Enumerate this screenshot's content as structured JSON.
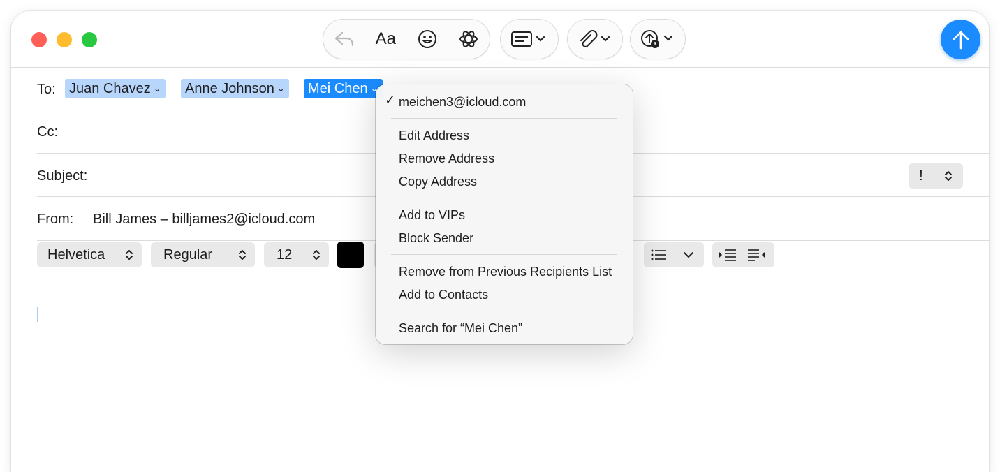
{
  "compose": {
    "to_label": "To:",
    "recipients": [
      {
        "name": "Juan Chavez",
        "selected": false
      },
      {
        "name": "Anne Johnson",
        "selected": false
      },
      {
        "name": "Mei Chen",
        "selected": true
      }
    ],
    "cc_label": "Cc:",
    "subject_label": "Subject:",
    "subject_value": "",
    "from_label": "From:",
    "from_value": "Bill James – billjames2@icloud.com",
    "priority_symbol": "!"
  },
  "format_bar": {
    "font": "Helvetica",
    "weight": "Regular",
    "size": "12",
    "text_color": "#000000"
  },
  "context_menu": {
    "checked_address": "meichen3@icloud.com",
    "items": [
      "Edit Address",
      "Remove Address",
      "Copy Address",
      "Add to VIPs",
      "Block Sender",
      "Remove from Previous Recipients List",
      "Add to Contacts",
      "Search for “Mei Chen”"
    ]
  },
  "colors": {
    "accent": "#1a8cff",
    "token_bg": "#b8d6fb",
    "close": "#ff5f57",
    "minimize": "#febc2e",
    "zoom": "#28c840"
  },
  "icons": [
    "reply-icon",
    "font-icon",
    "emoji-icon",
    "writing-tools-icon",
    "header-fields-icon",
    "attachment-icon",
    "send-later-icon",
    "send-icon",
    "list-icon",
    "indent-icon",
    "outdent-icon"
  ]
}
